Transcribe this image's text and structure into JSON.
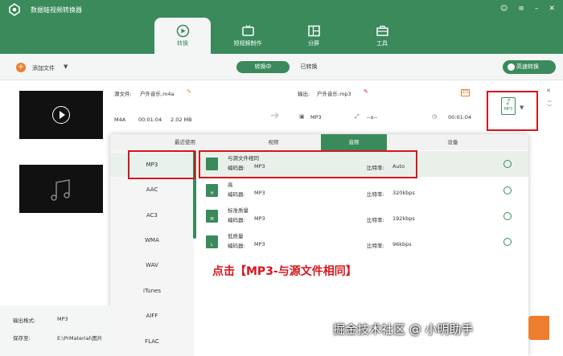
{
  "app": {
    "title": "数据蛙视频转换器"
  },
  "nav": [
    {
      "label": "转换",
      "icon": "convert-icon"
    },
    {
      "label": "短视频制作",
      "icon": "tv-icon"
    },
    {
      "label": "分屏",
      "icon": "split-icon"
    },
    {
      "label": "工具",
      "icon": "toolbox-icon"
    }
  ],
  "toolbar": {
    "add_label": "添加文件",
    "converting": "转换中",
    "converted": "已转换",
    "highspeed": "高速转换"
  },
  "file": {
    "source_label": "源文件:",
    "source_name": "户外音乐.m4a",
    "output_label": "输出:",
    "output_name": "户外音乐.mp3",
    "in_format": "M4A",
    "in_duration": "00:01:04",
    "in_size": "2.02 MB",
    "out_format": "MP3",
    "out_res": "--x--",
    "out_duration": "00:01:04",
    "format_icon": "MP3"
  },
  "popup": {
    "tabs": [
      "最近使用",
      "视频",
      "音频",
      "设备"
    ],
    "active_tab": "音频",
    "formats": [
      "MP3",
      "AAC",
      "AC3",
      "WMA",
      "WAV",
      "iTunes",
      "AIFF",
      "FLAC"
    ],
    "selected_format": "MP3",
    "encoder_label": "编码器:",
    "bitrate_label": "比特率:",
    "options": [
      {
        "name": "与源文件相同",
        "encoder": "MP3",
        "bitrate": "Auto",
        "badge": ""
      },
      {
        "name": "高",
        "encoder": "MP3",
        "bitrate": "320kbps",
        "badge": "H"
      },
      {
        "name": "标准质量",
        "encoder": "MP3",
        "bitrate": "192kbps",
        "badge": "M"
      },
      {
        "name": "低质量",
        "encoder": "MP3",
        "bitrate": "96kbps",
        "badge": "L"
      }
    ]
  },
  "bottom": {
    "format_label": "输出格式:",
    "format_value": "MP3",
    "save_label": "保存至:",
    "save_value": "E:\\PrMaterial\\图片"
  },
  "annotation": "点击【MP3-与源文件相同】",
  "watermark": "掘金技术社区 @ 小明助手",
  "colors": {
    "brand": "#3a8a5c",
    "accent": "#ef7d2e",
    "highlight": "#d7161d"
  }
}
